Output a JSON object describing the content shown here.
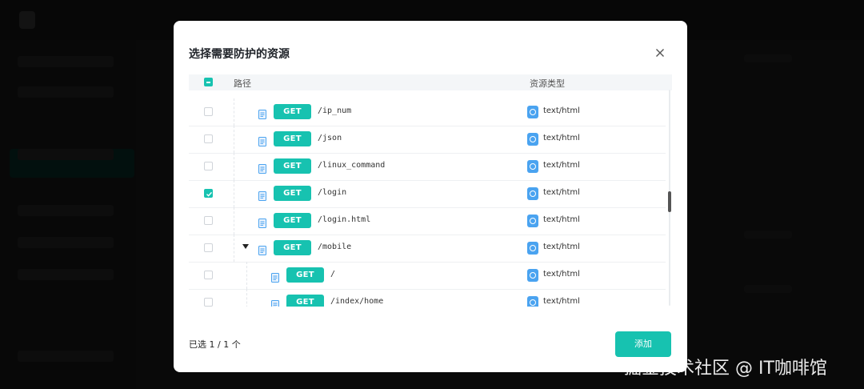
{
  "modal": {
    "title": "选择需要防护的资源",
    "columns": {
      "path": "路径",
      "resource_type": "资源类型"
    },
    "rows": [
      {
        "method": "GET",
        "path": "/ip_num",
        "type": "text/html",
        "checked": false,
        "depth": 1,
        "expandable": false
      },
      {
        "method": "GET",
        "path": "/json",
        "type": "text/html",
        "checked": false,
        "depth": 1,
        "expandable": false
      },
      {
        "method": "GET",
        "path": "/linux_command",
        "type": "text/html",
        "checked": false,
        "depth": 1,
        "expandable": false
      },
      {
        "method": "GET",
        "path": "/login",
        "type": "text/html",
        "checked": true,
        "depth": 1,
        "expandable": false
      },
      {
        "method": "GET",
        "path": "/login.html",
        "type": "text/html",
        "checked": false,
        "depth": 1,
        "expandable": false
      },
      {
        "method": "GET",
        "path": "/mobile",
        "type": "text/html",
        "checked": false,
        "depth": 1,
        "expandable": true
      },
      {
        "method": "GET",
        "path": "/",
        "type": "text/html",
        "checked": false,
        "depth": 2,
        "expandable": false
      },
      {
        "method": "GET",
        "path": "/index/home",
        "type": "text/html",
        "checked": false,
        "depth": 2,
        "expandable": false
      }
    ],
    "selected_count": "已选 1 / 1 个",
    "add_button": "添加"
  },
  "icons": {
    "close": "close-icon",
    "document": "document-icon",
    "html_type": "html-type-icon",
    "expand": "caret-down-icon"
  },
  "colors": {
    "accent": "#17c2b0",
    "type_icon": "#4aa3f0"
  },
  "watermark": "掘金技术社区 @ IT咖啡馆"
}
